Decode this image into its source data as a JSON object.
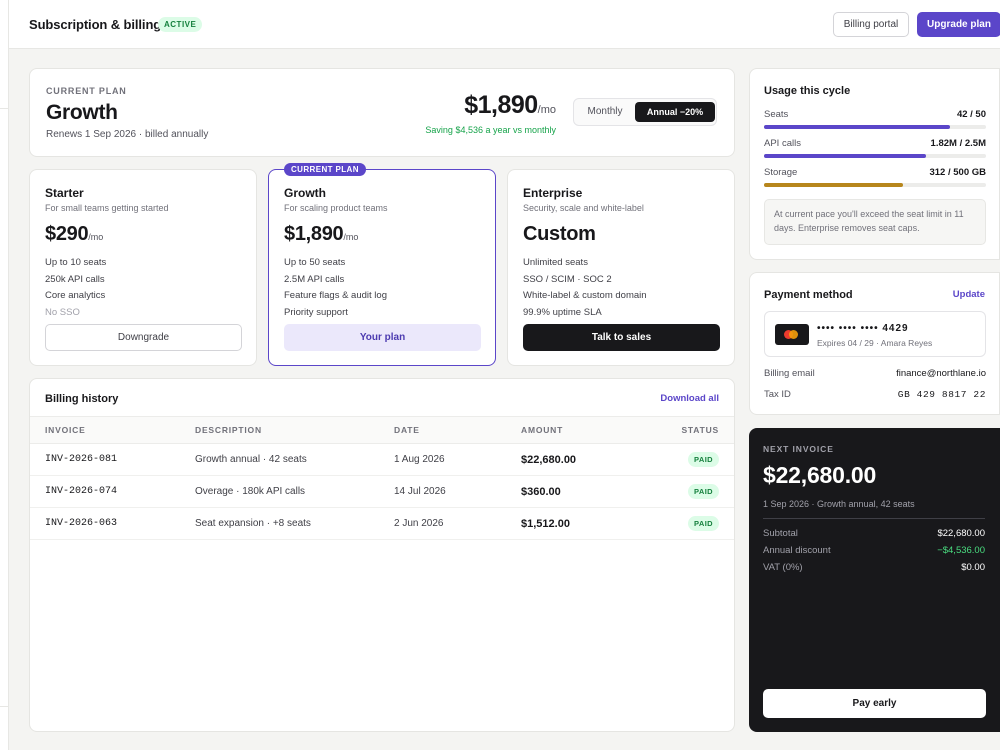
{
  "header": {
    "title": "Subscription & billing",
    "status": "ACTIVE",
    "portal_label": "Billing portal",
    "upgrade_label": "Upgrade plan"
  },
  "current_plan": {
    "label": "CURRENT PLAN",
    "name": "Growth",
    "renews": "Renews 1 Sep 2026 · billed annually",
    "price": "$1,890",
    "per": "/mo",
    "saving": "Saving $4,536 a year vs monthly",
    "toggle": {
      "monthly": "Monthly",
      "annual": "Annual −20%"
    }
  },
  "tiers": {
    "starter": {
      "name": "Starter",
      "sub": "For small teams getting started",
      "price": "$290",
      "per": "/mo",
      "features": [
        "Up to 10 seats",
        "250k API calls",
        "Core analytics",
        "No SSO"
      ],
      "button": "Downgrade"
    },
    "growth": {
      "badge": "CURRENT PLAN",
      "name": "Growth",
      "sub": "For scaling product teams",
      "price": "$1,890",
      "per": "/mo",
      "features": [
        "Up to 50 seats",
        "2.5M API calls",
        "Feature flags & audit log",
        "Priority support"
      ],
      "button": "Your plan"
    },
    "enterprise": {
      "name": "Enterprise",
      "sub": "Security, scale and white-label",
      "price": "Custom",
      "features": [
        "Unlimited seats",
        "SSO / SCIM · SOC 2",
        "White-label & custom domain",
        "99.9% uptime SLA"
      ],
      "button": "Talk to sales"
    }
  },
  "billing_history": {
    "title": "Billing history",
    "download": "Download all",
    "columns": [
      "INVOICE",
      "DESCRIPTION",
      "DATE",
      "AMOUNT",
      "STATUS"
    ],
    "rows": [
      {
        "invoice": "INV-2026-081",
        "description": "Growth annual · 42 seats",
        "date": "1 Aug 2026",
        "amount": "$22,680.00",
        "status": "PAID"
      },
      {
        "invoice": "INV-2026-074",
        "description": "Overage · 180k API calls",
        "date": "14 Jul 2026",
        "amount": "$360.00",
        "status": "PAID"
      },
      {
        "invoice": "INV-2026-063",
        "description": "Seat expansion · +8 seats",
        "date": "2 Jun 2026",
        "amount": "$1,512.00",
        "status": "PAID"
      }
    ]
  },
  "usage": {
    "title": "Usage this cycle",
    "items": [
      {
        "label": "Seats",
        "value": "42 / 50",
        "fraction": 0.84,
        "color": "#5b46c9"
      },
      {
        "label": "API calls",
        "value": "1.82M / 2.5M",
        "fraction": 0.728,
        "color": "#5b46c9"
      },
      {
        "label": "Storage",
        "value": "312 / 500 GB",
        "fraction": 0.624,
        "color": "#b7861c"
      }
    ],
    "note": "At current pace you'll exceed the seat limit in 11 days. Enterprise removes seat caps."
  },
  "payment": {
    "title": "Payment method",
    "update": "Update",
    "card_number": "•••• •••• •••• 4429",
    "card_expiry": "Expires 04 / 29 · Amara Reyes",
    "email_label": "Billing email",
    "email": "finance@northlane.io",
    "tax_label": "Tax ID",
    "tax_id": "GB 429 8817 22"
  },
  "next_invoice": {
    "label": "NEXT INVOICE",
    "amount": "$22,680.00",
    "desc": "1 Sep 2026 · Growth annual, 42 seats",
    "subtotal_label": "Subtotal",
    "subtotal": "$22,680.00",
    "discount_label": "Annual discount",
    "discount": "−$4,536.00",
    "vat_label": "VAT (0%)",
    "vat": "$0.00",
    "button": "Pay early"
  },
  "colors": {
    "accent": "#5b46c9",
    "success": "#16a34a",
    "dark": "#18181b"
  }
}
